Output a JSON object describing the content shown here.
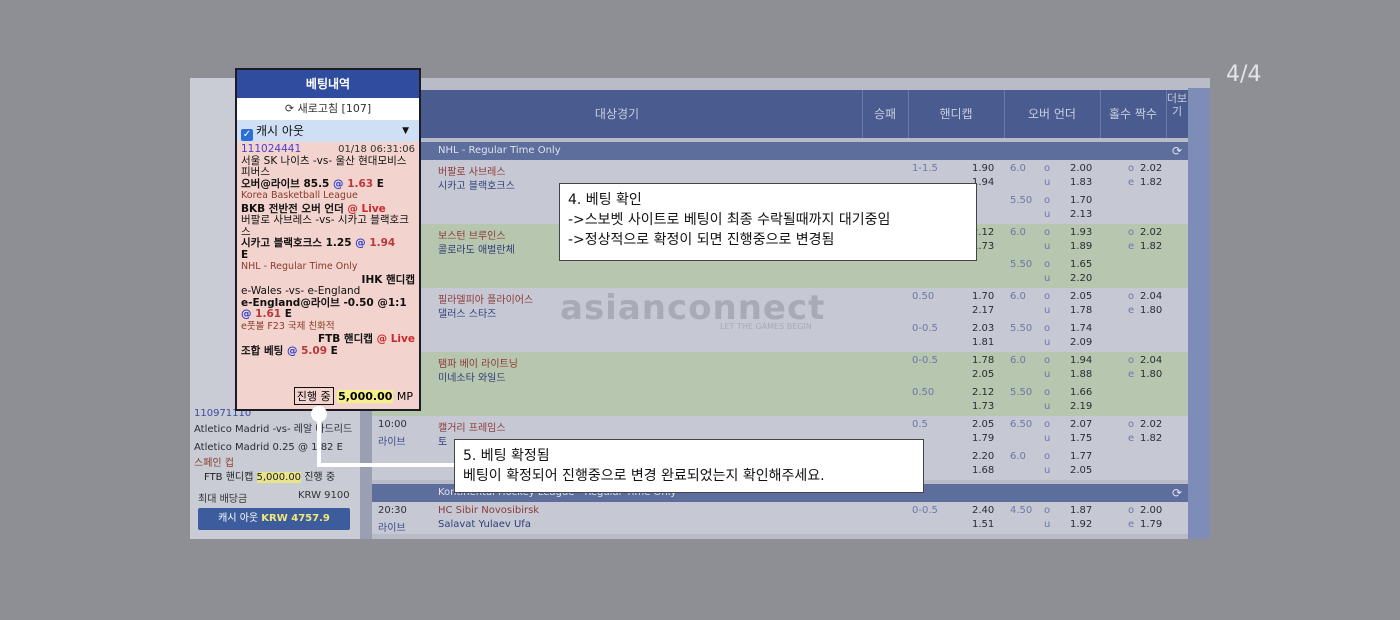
{
  "page_counter": "4/4",
  "table": {
    "headers": [
      "대상경기",
      "승패",
      "핸디캡",
      "오버 언더",
      "홀수 짝수",
      "더보기"
    ],
    "leagues": [
      "NHL - Regular Time Only",
      "Kontinental Hockey League - Regular Time Only"
    ],
    "matches": [
      {
        "time": "",
        "home": "버팔로 사브레스",
        "away": "시카고 블랙호크스",
        "hcp": "1-1.5",
        "hcp_home": "1.90",
        "hcp_away": "1.94",
        "ou_line": "6.0",
        "over": "2.00",
        "under": "1.83",
        "odd": "2.02",
        "even": "1.82"
      },
      {
        "time": "",
        "home": "",
        "away": "",
        "hcp": "",
        "hcp_home": "",
        "hcp_away": "",
        "ou_line": "5.50",
        "over": "1.70",
        "under": "2.13",
        "odd": "",
        "even": ""
      },
      {
        "time": "",
        "home": "보스턴 브루인스",
        "away": "콜로라도 애벌란체",
        "hcp": "",
        "hcp_home": "2.12",
        "hcp_away": "1.73",
        "ou_line": "6.0",
        "over": "1.93",
        "under": "1.89",
        "odd": "2.02",
        "even": "1.82"
      },
      {
        "time": "",
        "home": "",
        "away": "",
        "hcp": "",
        "hcp_home": "",
        "hcp_away": "",
        "ou_line": "5.50",
        "over": "1.65",
        "under": "2.20",
        "odd": "",
        "even": ""
      },
      {
        "time": "",
        "home": "필라델피아 플라이어스",
        "away": "댈러스 스타즈",
        "hcp": "0.50",
        "hcp_home": "1.70",
        "hcp_away": "2.17",
        "ou_line": "6.0",
        "over": "2.05",
        "under": "1.78",
        "odd": "2.04",
        "even": "1.80"
      },
      {
        "time": "",
        "home": "",
        "away": "",
        "hcp": "0-0.5",
        "hcp_home": "2.03",
        "hcp_away": "1.81",
        "ou_line": "5.50",
        "over": "1.74",
        "under": "2.09",
        "odd": "",
        "even": ""
      },
      {
        "time": "",
        "home": "탬파 베이 라이트닝",
        "away": "미네소타 와일드",
        "hcp": "0-0.5",
        "hcp_home": "1.78",
        "hcp_away": "2.05",
        "ou_line": "6.0",
        "over": "1.94",
        "under": "1.88",
        "odd": "2.04",
        "even": "1.80"
      },
      {
        "time": "",
        "home": "",
        "away": "",
        "hcp": "0.50",
        "hcp_home": "2.12",
        "hcp_away": "1.73",
        "ou_line": "5.50",
        "over": "1.66",
        "under": "2.19",
        "odd": "",
        "even": ""
      },
      {
        "time": "10:00",
        "live": "라이브",
        "home": "캘거리 프레임스",
        "away": "토",
        "hcp": "0.5",
        "hcp_home": "2.05",
        "hcp_away": "1.79",
        "ou_line": "6.50",
        "over": "2.07",
        "under": "1.75",
        "odd": "2.02",
        "even": "1.82"
      },
      {
        "time": "",
        "home": "",
        "away": "",
        "hcp": "",
        "hcp_home": "2.20",
        "hcp_away": "1.68",
        "ou_line": "6.0",
        "over": "1.77",
        "under": "2.05",
        "odd": "",
        "even": ""
      },
      {
        "time": "20:30",
        "live": "라이브",
        "home": "HC Sibir Novosibirsk",
        "away": "Salavat Yulaev Ufa",
        "hcp": "0-0.5",
        "hcp_home": "2.40",
        "hcp_away": "1.51",
        "ou_line": "4.50",
        "over": "1.87",
        "under": "1.92",
        "odd": "2.00",
        "even": "1.79"
      }
    ],
    "watermark": "asianconnect",
    "watermark_sub": "LET THE GAMES BEGIN"
  },
  "left_bg": {
    "bet_id": "110971110",
    "line1": "Atletico Madrid -vs- 레알 마드리드",
    "line2": "Atletico Madrid 0.25 @ 1.82 E",
    "line3": "스페인 컵",
    "line4": "FTB 핸디캡",
    "amount": "5,000.00",
    "status": "진행 중",
    "max_label": "최대 배당금",
    "max_value": "KRW 9100",
    "cashout_label": "캐시 아웃",
    "cashout_value": "KRW 4757.9"
  },
  "panel": {
    "title": "베팅내역",
    "refresh_label": "새로고침 [107]",
    "cashout_label": "캐시 아웃",
    "bet_id": "111024441",
    "bet_date": "01/18 06:31:06",
    "bet1_match": "서울 SK 나이츠 -vs- 울산 현대모비스 피버스",
    "bet1_pick": "오버@라이브 85.5",
    "bet1_odds": "1.63",
    "bet1_league": "Korea Basketball League",
    "bet2_head": "BKB 전반전 오버 언더",
    "live": "@ Live",
    "bet2_match": "버팔로 사브레스 -vs- 시카고 블랙호크스",
    "bet2_pick": "시카고 블랙호크스 1.25",
    "bet2_odds": "1.94",
    "bet2_league": "NHL - Regular Time Only",
    "bet3_head": "IHK 핸디캡",
    "bet3_match": "e-Wales -vs- e-England",
    "bet3_pick": "e-England@라이브 -0.50 @1:1",
    "bet3_odds": "1.61",
    "bet3_league": "e풋볼 F23 국제 친화적",
    "combo_head": "FTB 핸디캡",
    "combo_label": "조합 베팅",
    "combo_odds": "5.09",
    "status": "진행 중",
    "amount": "5,000.00",
    "currency": "MP"
  },
  "callouts": {
    "step4_title": "4. 베팅 확인",
    "step4_line1": "->스보벳 사이트로 베팅이 최종 수락될때까지 대기중임",
    "step4_line2": "->정상적으로 확정이 되면 진행중으로 변경됨",
    "step5_title": "5. 베팅 확정됨",
    "step5_line1": "베팅이 확정되어 진행중으로 변경 완료되었는지 확인해주세요."
  }
}
